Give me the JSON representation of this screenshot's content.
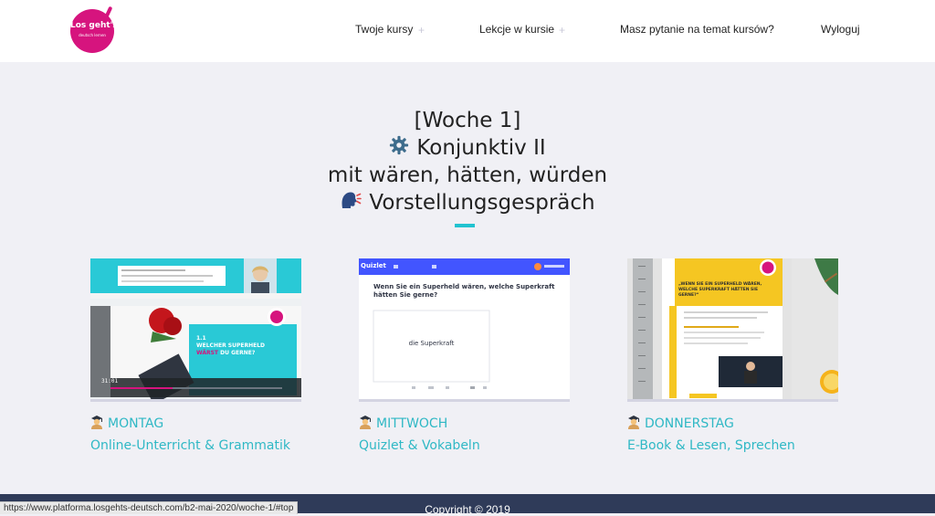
{
  "header": {
    "logo_text": "Los geht's",
    "logo_subtext": "deutsch lernen",
    "nav": [
      {
        "label": "Twoje kursy",
        "has_submenu": true
      },
      {
        "label": "Lekcje w kursie",
        "has_submenu": true
      },
      {
        "label": "Masz pytanie na temat kursów?",
        "has_submenu": false
      },
      {
        "label": "Wyloguj",
        "has_submenu": false
      }
    ],
    "plus_symbol": "+"
  },
  "page": {
    "title_line1": "[Woche 1]",
    "title_line2": "Konjunktiv II",
    "title_line3": "mit wären, hätten, würden",
    "title_line4": "Vorstellungsgespräch",
    "title_icon2": "gear-icon",
    "title_icon4": "speaking-head-icon"
  },
  "cards": [
    {
      "day": "MONTAG",
      "subtitle": "Online-Unterricht & Grammatik",
      "icon": "student-icon",
      "thumb": {
        "video_time": "31:01",
        "slide_number": "1.1",
        "slide_title_a": "WELCHER SUPERHELD",
        "slide_title_b": "WÄRST",
        "slide_title_c": "DU GERNE?"
      }
    },
    {
      "day": "MITTWOCH",
      "subtitle": "Quizlet & Vokabeln",
      "icon": "student-icon",
      "thumb": {
        "app_name": "Quizlet",
        "question": "Wenn Sie ein Superheld wären, welche Superkraft hätten Sie gerne?",
        "flashcard": "die Superkraft"
      }
    },
    {
      "day": "DONNERSTAG",
      "subtitle": "E-Book & Lesen, Sprechen",
      "icon": "student-icon",
      "thumb": {
        "book_title": "„WENN SIE EIN SUPERHELD WÄREN, WELCHE SUPERKRAFT HÄTTEN SIE GERNE?“"
      }
    }
  ],
  "footer": {
    "copyright": "Copyright © 2019"
  },
  "status_url": "https://www.platforma.losgehts-deutsch.com/b2-mai-2020/woche-1/#top",
  "colors": {
    "accent": "#21c3d0",
    "link": "#2fb8c5",
    "brand": "#d6147e",
    "footer": "#2f3b59",
    "background": "#f0f0f5"
  }
}
